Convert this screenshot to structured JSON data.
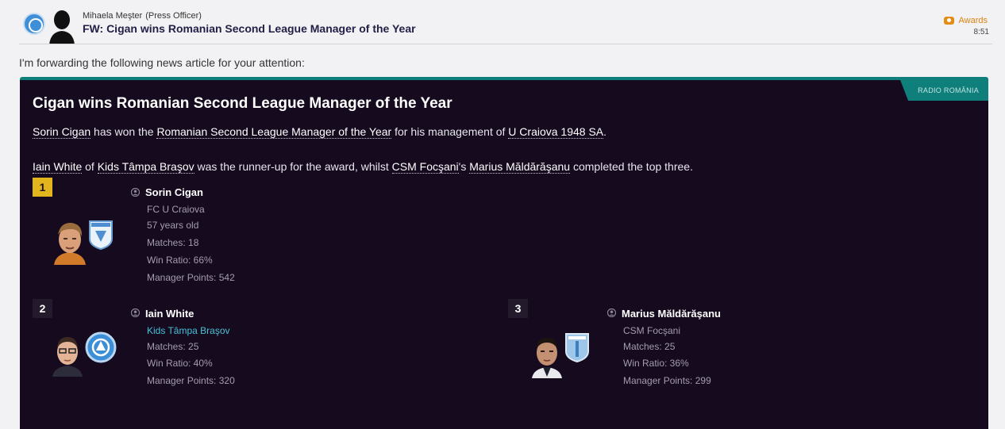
{
  "header": {
    "sender_name": "Mihaela Meşter",
    "sender_role": "(Press Officer)",
    "subject": "FW: Cigan wins Romanian Second League Manager of the Year",
    "category": "Awards",
    "time": "8:51"
  },
  "intro": "I'm forwarding the following news article for your attention:",
  "article": {
    "source": "RADIO ROMÂNIA",
    "title": "Cigan wins Romanian Second League Manager of the Year",
    "p1": {
      "winner": "Sorin Cigan",
      "t1": " has won the ",
      "award": "Romanian Second League Manager of the Year",
      "t2": " for his management of ",
      "club": "U Craiova 1948 SA",
      "t3": "."
    },
    "p2": {
      "runner": "Iain White",
      "t1": " of ",
      "runner_club": "Kids Tâmpa Braşov",
      "t2": " was the runner-up for the award, whilst ",
      "third_club": "CSM Focşani",
      "t3": "'s ",
      "third": "Marius Măldărăşanu",
      "t4": " completed the top three."
    }
  },
  "placings": [
    {
      "rank": "1",
      "name": "Sorin Cigan",
      "club": "FC U Craiova",
      "age": "57 years old",
      "matches": "Matches: 18",
      "win_ratio": "Win Ratio: 66%",
      "points": "Manager Points: 542"
    },
    {
      "rank": "2",
      "name": "Iain White",
      "club": "Kids Tâmpa Braşov",
      "matches": "Matches: 25",
      "win_ratio": "Win Ratio: 40%",
      "points": "Manager Points: 320"
    },
    {
      "rank": "3",
      "name": "Marius Măldărăşanu",
      "club": "CSM Focşani",
      "matches": "Matches: 25",
      "win_ratio": "Win Ratio: 36%",
      "points": "Manager Points: 299"
    }
  ],
  "colors": {
    "card_bg": "#150a1e",
    "accent_teal": "#0f7f7c",
    "gold_rank": "#e2b51c",
    "awards_orange": "#e48d15",
    "link_cyan": "#48c2d8"
  }
}
